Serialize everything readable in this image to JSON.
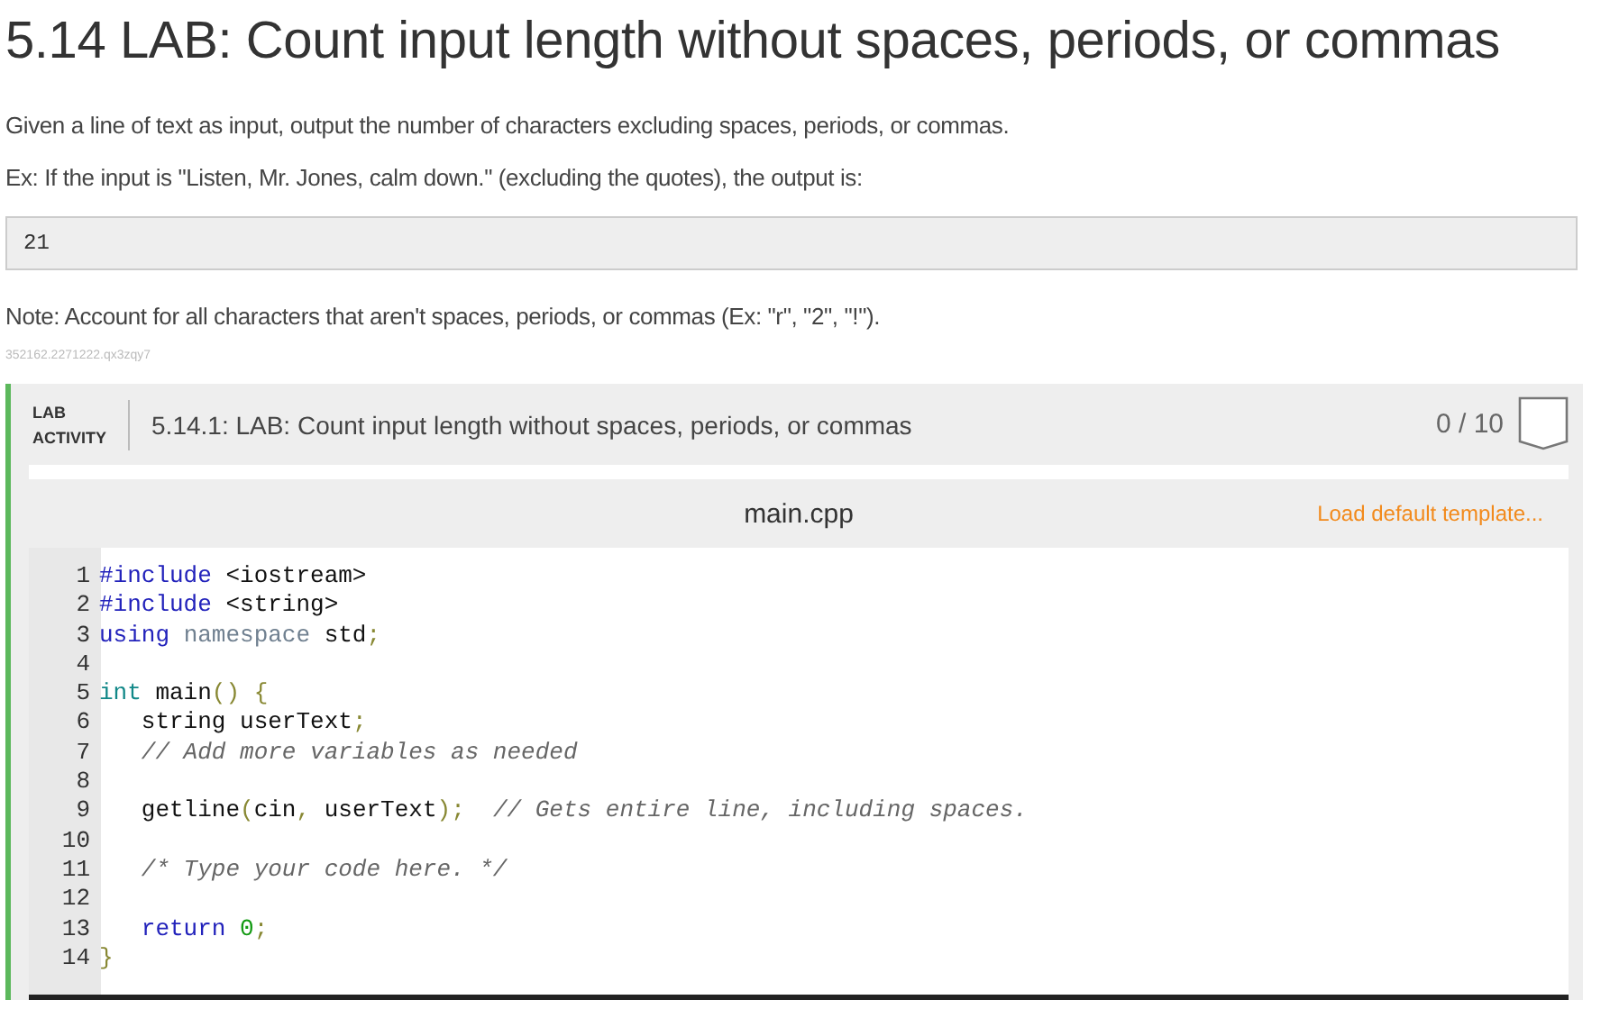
{
  "title": "5.14 LAB: Count input length without spaces, periods, or commas",
  "paragraphs": [
    "Given a line of text as input, output the number of characters excluding spaces, periods, or commas.",
    "Ex: If the input is \"Listen, Mr. Jones, calm down.\" (excluding the quotes), the output is:"
  ],
  "example_output": "21",
  "note": "Note: Account for all characters that aren't spaces, periods, or commas (Ex: \"r\", \"2\", \"!\").",
  "id_text": "352162.2271222.qx3zqy7",
  "activity": {
    "label_line1": "LAB",
    "label_line2": "ACTIVITY",
    "title": "5.14.1: LAB: Count input length without spaces, periods, or commas",
    "score": "0 / 10"
  },
  "editor": {
    "filename": "main.cpp",
    "template_link": "Load default template...",
    "lines": [
      {
        "number": "1",
        "tokens": [
          {
            "text": "#include",
            "kind": "meta"
          },
          {
            "text": " <iostream>",
            "kind": "plain"
          }
        ]
      },
      {
        "number": "2",
        "tokens": [
          {
            "text": "#include",
            "kind": "meta"
          },
          {
            "text": " <string>",
            "kind": "plain"
          }
        ]
      },
      {
        "number": "3",
        "tokens": [
          {
            "text": "using",
            "kind": "keyword"
          },
          {
            "text": " namespace",
            "kind": "ns"
          },
          {
            "text": " std",
            "kind": "plain"
          },
          {
            "text": ";",
            "kind": "punct"
          }
        ]
      },
      {
        "number": "4"
      },
      {
        "number": "5",
        "tokens": [
          {
            "text": "int",
            "kind": "type"
          },
          {
            "text": " main",
            "kind": "plain"
          },
          {
            "text": "() {",
            "kind": "punct"
          }
        ]
      },
      {
        "number": "6",
        "tokens": [
          {
            "text": "   string userText",
            "kind": "plain"
          },
          {
            "text": ";",
            "kind": "punct"
          }
        ]
      },
      {
        "number": "7",
        "tokens": [
          {
            "text": "   // Add more variables as needed",
            "kind": "comment"
          }
        ]
      },
      {
        "number": "8"
      },
      {
        "number": "9",
        "tokens": [
          {
            "text": "   getline",
            "kind": "plain"
          },
          {
            "text": "(",
            "kind": "punct"
          },
          {
            "text": "cin",
            "kind": "plain"
          },
          {
            "text": ",",
            "kind": "punct"
          },
          {
            "text": " userText",
            "kind": "plain"
          },
          {
            "text": ");",
            "kind": "punct"
          },
          {
            "text": "  // Gets entire line, including spaces.",
            "kind": "comment"
          }
        ]
      },
      {
        "number": "10"
      },
      {
        "number": "11",
        "tokens": [
          {
            "text": "   /* Type your code here. */",
            "kind": "comment"
          }
        ]
      },
      {
        "number": "12"
      },
      {
        "number": "13",
        "tokens": [
          {
            "text": "   return",
            "kind": "keyword"
          },
          {
            "text": " 0",
            "kind": "number"
          },
          {
            "text": ";",
            "kind": "punct"
          }
        ]
      },
      {
        "number": "14",
        "tokens": [
          {
            "text": "}",
            "kind": "punct"
          }
        ]
      }
    ]
  }
}
